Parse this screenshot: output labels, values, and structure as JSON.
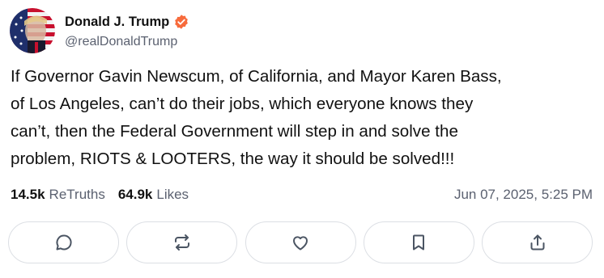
{
  "author": {
    "display_name": "Donald J. Trump",
    "handle": "@realDonaldTrump",
    "verified": true,
    "verified_color": "#f76b3c"
  },
  "post": {
    "text": "If Governor Gavin Newscum, of California, and Mayor Karen Bass,\nof Los Angeles, can’t do their jobs, which everyone knows they\ncan’t, then the Federal Government will step in and solve the\nproblem, RIOTS & LOOTERS, the way it should be solved!!!"
  },
  "stats": {
    "retruths_count": "14.5k",
    "retruths_label": "ReTruths",
    "likes_count": "64.9k",
    "likes_label": "Likes",
    "timestamp": "Jun 07, 2025, 5:25 PM"
  },
  "actions": [
    {
      "name": "reply",
      "icon": "comment-icon"
    },
    {
      "name": "retruth",
      "icon": "retruth-icon"
    },
    {
      "name": "like",
      "icon": "heart-icon"
    },
    {
      "name": "bookmark",
      "icon": "bookmark-icon"
    },
    {
      "name": "share",
      "icon": "share-icon"
    }
  ],
  "colors": {
    "text": "#111111",
    "muted": "#5b6170",
    "border": "#dcdfe4",
    "icon": "#4b5563"
  }
}
